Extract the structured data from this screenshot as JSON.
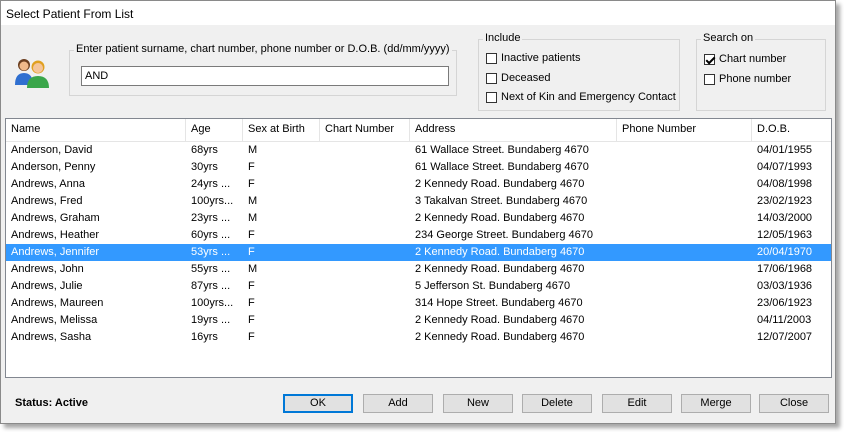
{
  "window": {
    "title": "Select Patient From List"
  },
  "search": {
    "label": "Enter patient surname, chart number, phone number or D.O.B. (dd/mm/yyyy)",
    "value": "AND"
  },
  "include": {
    "label": "Include",
    "options": [
      {
        "label": "Inactive patients",
        "checked": false
      },
      {
        "label": "Deceased",
        "checked": false
      },
      {
        "label": "Next of Kin and Emergency Contact",
        "checked": false
      }
    ]
  },
  "search_on": {
    "label": "Search on",
    "options": [
      {
        "label": "Chart number",
        "checked": true
      },
      {
        "label": "Phone number",
        "checked": false
      }
    ]
  },
  "table": {
    "columns": [
      "Name",
      "Age",
      "Sex at Birth",
      "Chart Number",
      "Address",
      "Phone Number",
      "D.O.B."
    ],
    "rows": [
      {
        "name": "Anderson, David",
        "age": "68yrs",
        "sex": "M",
        "chart": "",
        "address": "61 Wallace Street. Bundaberg 4670",
        "phone": "",
        "dob": "04/01/1955"
      },
      {
        "name": "Anderson, Penny",
        "age": "30yrs",
        "sex": "F",
        "chart": "",
        "address": "61 Wallace Street. Bundaberg 4670",
        "phone": "",
        "dob": "04/07/1993"
      },
      {
        "name": "Andrews, Anna",
        "age": "24yrs ...",
        "sex": "F",
        "chart": "",
        "address": "2 Kennedy Road. Bundaberg 4670",
        "phone": "",
        "dob": "04/08/1998"
      },
      {
        "name": "Andrews, Fred",
        "age": "100yrs...",
        "sex": "M",
        "chart": "",
        "address": "3 Takalvan Street. Bundaberg 4670",
        "phone": "",
        "dob": "23/02/1923"
      },
      {
        "name": "Andrews, Graham",
        "age": "23yrs ...",
        "sex": "M",
        "chart": "",
        "address": "2 Kennedy Road. Bundaberg 4670",
        "phone": "",
        "dob": "14/03/2000"
      },
      {
        "name": "Andrews, Heather",
        "age": "60yrs ...",
        "sex": "F",
        "chart": "",
        "address": "234 George Street. Bundaberg 4670",
        "phone": "",
        "dob": "12/05/1963"
      },
      {
        "name": "Andrews, Jennifer",
        "age": "53yrs ...",
        "sex": "F",
        "chart": "",
        "address": "2 Kennedy Road. Bundaberg 4670",
        "phone": "",
        "dob": "20/04/1970"
      },
      {
        "name": "Andrews, John",
        "age": "55yrs ...",
        "sex": "M",
        "chart": "",
        "address": "2 Kennedy Road. Bundaberg 4670",
        "phone": "",
        "dob": "17/06/1968"
      },
      {
        "name": "Andrews, Julie",
        "age": "87yrs ...",
        "sex": "F",
        "chart": "",
        "address": "5 Jefferson St. Bundaberg 4670",
        "phone": "",
        "dob": "03/03/1936"
      },
      {
        "name": "Andrews, Maureen",
        "age": "100yrs...",
        "sex": "F",
        "chart": "",
        "address": "314 Hope Street. Bundaberg 4670",
        "phone": "",
        "dob": "23/06/1923"
      },
      {
        "name": "Andrews, Melissa",
        "age": "19yrs ...",
        "sex": "F",
        "chart": "",
        "address": "2 Kennedy Road. Bundaberg 4670",
        "phone": "",
        "dob": "04/11/2003"
      },
      {
        "name": "Andrews, Sasha",
        "age": "16yrs",
        "sex": "F",
        "chart": "",
        "address": "2 Kennedy Road. Bundaberg 4670",
        "phone": "",
        "dob": "12/07/2007"
      }
    ],
    "selected_row": 6
  },
  "status": {
    "text": "Status: Active"
  },
  "buttons": {
    "ok": "OK",
    "add": "Add",
    "new": "New",
    "delete": "Delete",
    "edit": "Edit",
    "merge": "Merge",
    "close": "Close"
  },
  "colors": {
    "selection": "#3399ff",
    "focus_border": "#0078d7"
  },
  "icons": {
    "avatar": "patients-group-icon"
  }
}
